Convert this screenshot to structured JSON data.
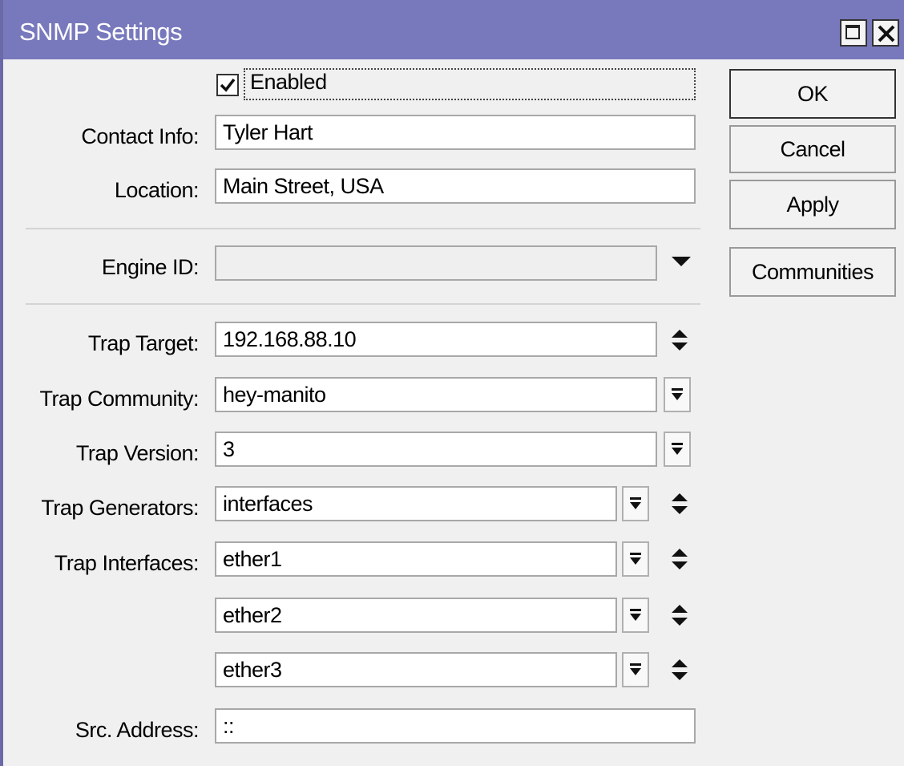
{
  "window": {
    "title": "SNMP Settings",
    "title_bar_color": "#7878bd",
    "maximize_icon": "maximize-icon",
    "close_icon": "close-icon"
  },
  "form": {
    "enabled": {
      "label": "Enabled",
      "checked": true
    },
    "contact_info": {
      "label": "Contact Info:",
      "value": "Tyler Hart"
    },
    "location": {
      "label": "Location:",
      "value": "Main Street, USA"
    },
    "engine_id": {
      "label": "Engine ID:",
      "value": ""
    },
    "trap_target": {
      "label": "Trap Target:",
      "value": "192.168.88.10"
    },
    "trap_community": {
      "label": "Trap Community:",
      "value": "hey-manito"
    },
    "trap_version": {
      "label": "Trap Version:",
      "value": "3"
    },
    "trap_generators": {
      "label": "Trap Generators:",
      "value": "interfaces"
    },
    "trap_interfaces": {
      "label": "Trap Interfaces:",
      "values": [
        "ether1",
        "ether2",
        "ether3"
      ]
    },
    "src_address": {
      "label": "Src. Address:",
      "value": "::"
    }
  },
  "buttons": {
    "ok": "OK",
    "cancel": "Cancel",
    "apply": "Apply",
    "communities": "Communities"
  }
}
